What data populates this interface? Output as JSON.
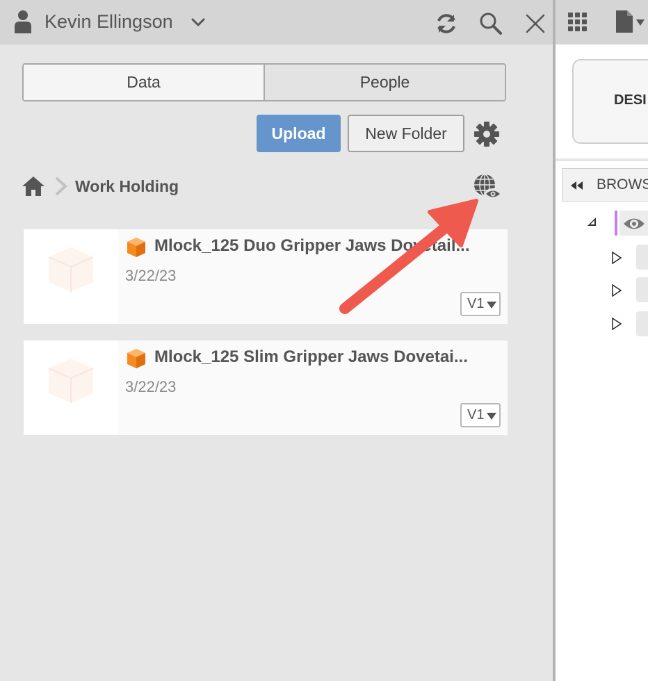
{
  "left_header": {
    "user_name": "Kevin Ellingson",
    "icons": [
      "person-icon",
      "chevron-down-icon",
      "refresh-icon",
      "search-icon",
      "close-icon"
    ]
  },
  "tabs": [
    {
      "label": "Data",
      "active": true
    },
    {
      "label": "People",
      "active": false
    }
  ],
  "actions": {
    "upload_label": "Upload",
    "new_folder_label": "New Folder"
  },
  "breadcrumb": {
    "current": "Work Holding"
  },
  "files": [
    {
      "title": "Mlock_125 Duo Gripper Jaws Dovetail...",
      "date": "3/22/23",
      "version": "V1"
    },
    {
      "title": "Mlock_125 Slim Gripper Jaws Dovetai...",
      "date": "3/22/23",
      "version": "V1"
    }
  ],
  "right_panel": {
    "design_label": "DESI",
    "browser_label": "BROWS"
  },
  "colors": {
    "accent_upload": "#6595cc",
    "annotation_arrow": "#ef5a4f",
    "file_icon": "#f58a1f",
    "tree_marker": "#c77eef"
  }
}
